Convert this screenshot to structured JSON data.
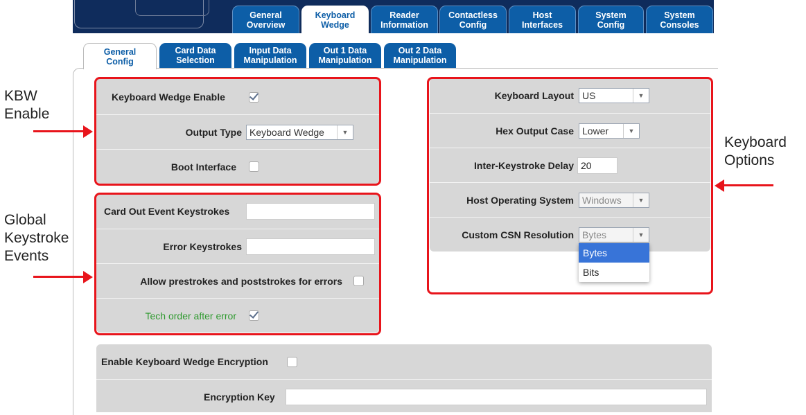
{
  "main_tabs": [
    {
      "label": "General\nOverview",
      "active": false
    },
    {
      "label": "Keyboard\nWedge",
      "active": true
    },
    {
      "label": "Reader\nInformation",
      "active": false
    },
    {
      "label": "Contactless\nConfig",
      "active": false
    },
    {
      "label": "Host\nInterfaces",
      "active": false
    },
    {
      "label": "System\nConfig",
      "active": false
    },
    {
      "label": "System\nConsoles",
      "active": false
    }
  ],
  "sub_tabs": [
    {
      "label": "General\nConfig",
      "active": true
    },
    {
      "label": "Card Data\nSelection",
      "active": false
    },
    {
      "label": "Input Data\nManipulation",
      "active": false
    },
    {
      "label": "Out 1 Data\nManipulation",
      "active": false
    },
    {
      "label": "Out 2 Data\nManipulation",
      "active": false
    }
  ],
  "kbw_panel": {
    "enable_label": "Keyboard Wedge Enable",
    "enable_checked": true,
    "output_type_label": "Output Type",
    "output_type_value": "Keyboard Wedge",
    "boot_interface_label": "Boot Interface",
    "boot_interface_checked": false
  },
  "keystroke_panel": {
    "card_out_label": "Card Out Event Keystrokes",
    "card_out_value": "",
    "error_label": "Error Keystrokes",
    "error_value": "",
    "allow_label": "Allow prestrokes and poststrokes for errors",
    "allow_checked": false,
    "tech_order_label": "Tech order after error",
    "tech_order_checked": true
  },
  "keyboard_panel": {
    "layout_label": "Keyboard Layout",
    "layout_value": "US",
    "hex_label": "Hex Output Case",
    "hex_value": "Lower",
    "delay_label": "Inter-Keystroke Delay",
    "delay_value": "20",
    "host_os_label": "Host Operating System",
    "host_os_value": "Windows",
    "csn_label": "Custom CSN Resolution",
    "csn_value": "Bytes",
    "csn_options": [
      "Bytes",
      "Bits"
    ],
    "csn_highlighted": "Bytes"
  },
  "encryption_panel": {
    "enable_label": "Enable Keyboard Wedge Encryption",
    "enable_checked": false,
    "key_label": "Encryption Key",
    "key_value": ""
  },
  "annotations": {
    "kbw_enable": "KBW\nEnable",
    "global_events": "Global\nKeystroke\nEvents",
    "keyboard_options": "Keyboard\nOptions"
  },
  "colors": {
    "tab_blue": "#0d5ea7",
    "top_bar": "#0f2c5c",
    "panel_gray": "#d7d7d7",
    "annotation_red": "#e8141b",
    "highlight_blue": "#3874d8",
    "green_label": "#2f9a2f"
  }
}
